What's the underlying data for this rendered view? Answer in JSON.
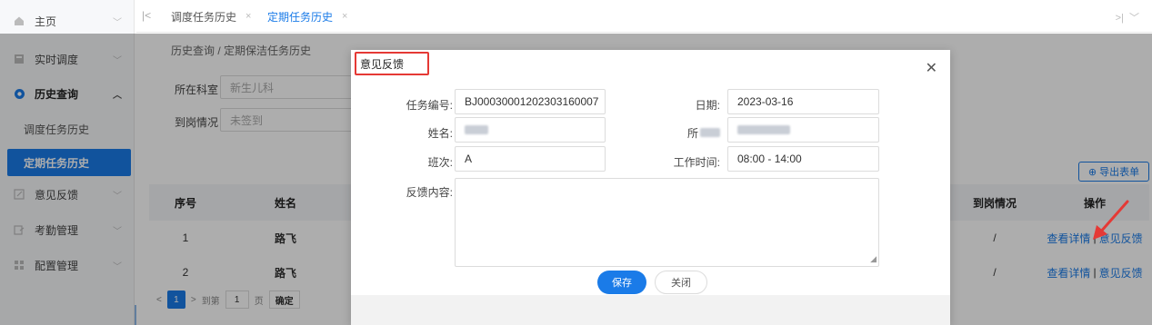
{
  "sidebar": {
    "items": [
      {
        "label": "主页",
        "icon": "home-icon"
      },
      {
        "label": "实时调度",
        "icon": "monitor-icon"
      },
      {
        "label": "历史查询",
        "icon": "history-icon"
      },
      {
        "label": "意见反馈",
        "icon": "edit-icon"
      },
      {
        "label": "考勤管理",
        "icon": "attendance-icon"
      },
      {
        "label": "配置管理",
        "icon": "grid-icon"
      }
    ],
    "sub_items": [
      {
        "label": "调度任务历史"
      },
      {
        "label": "定期任务历史"
      }
    ]
  },
  "tabs": [
    {
      "label": "调度任务历史"
    },
    {
      "label": "定期任务历史"
    }
  ],
  "breadcrumb": "历史查询 / 定期保洁任务历史",
  "filters": {
    "dept_label": "所在科室",
    "dept_value": "新生儿科",
    "arrival_label": "到岗情况",
    "arrival_value": "未签到"
  },
  "export_label": "导出表单",
  "table": {
    "headers": {
      "no": "序号",
      "name": "姓名",
      "arrival": "到岗情况",
      "ops": "操作"
    },
    "rows": [
      {
        "no": "1",
        "name": "路飞",
        "arrival": "/",
        "detail": "查看详情",
        "sep": "|",
        "feedback": "意见反馈"
      },
      {
        "no": "2",
        "name": "路飞",
        "arrival": "/",
        "detail": "查看详情",
        "sep": "|",
        "feedback": "意见反馈"
      }
    ]
  },
  "pager": {
    "page": "1",
    "goto": "到第",
    "input": "1",
    "unit": "页",
    "confirm": "确定"
  },
  "modal": {
    "title": "意见反馈",
    "task_no_label": "任务编号:",
    "task_no": "BJ00030001202303160007",
    "date_label": "日期:",
    "date": "2023-03-16",
    "name_label": "姓名:",
    "dept_label": "所",
    "shift_label": "班次:",
    "shift": "A",
    "work_time_label": "工作时间:",
    "work_time": "08:00 - 14:00",
    "content_label": "反馈内容:",
    "save": "保存",
    "close": "关闭"
  },
  "colors": {
    "accent": "#1a7be8",
    "highlight": "#e53935"
  }
}
